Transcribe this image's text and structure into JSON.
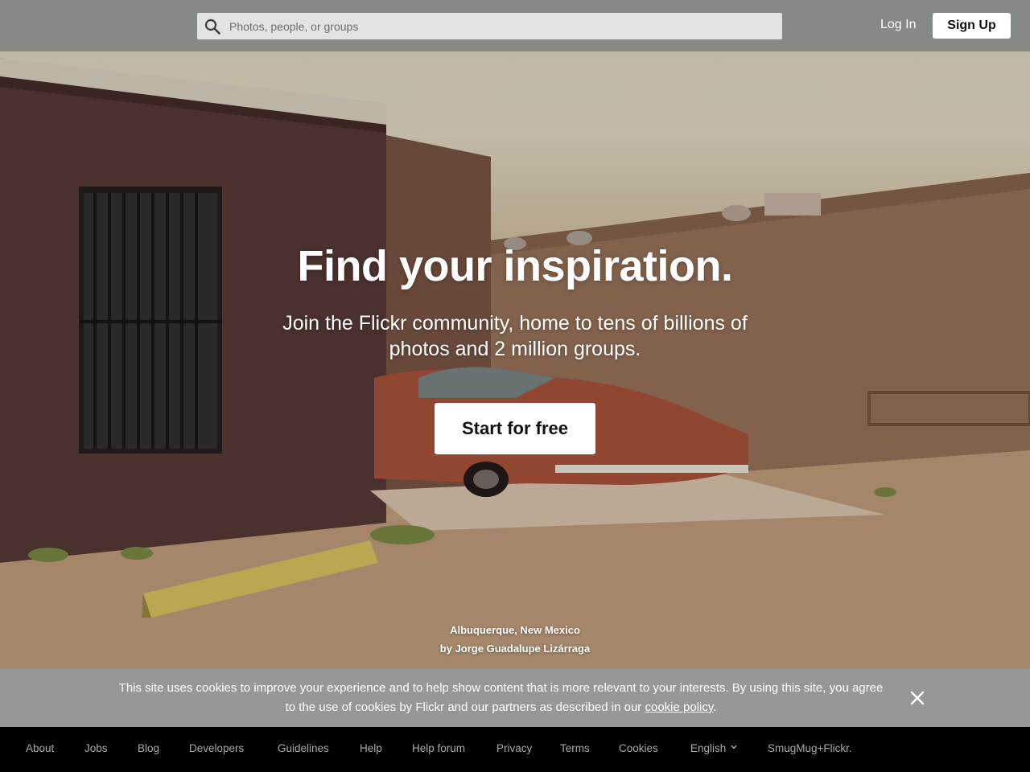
{
  "header": {
    "search_placeholder": "Photos, people, or groups",
    "login_label": "Log In",
    "signup_label": "Sign Up"
  },
  "hero": {
    "headline": "Find your inspiration.",
    "subline": "Join the Flickr community, home to tens of billions of photos and 2 million groups.",
    "cta_label": "Start for free",
    "credit_location": "Albuquerque, New Mexico",
    "credit_author": "by Jorge Guadalupe Lizárraga"
  },
  "cookie_banner": {
    "message": "This site uses cookies to improve your experience and to help show content that is more relevant to your interests. By using this site, you agree to the use of cookies by Flickr and our partners as described in our",
    "link_label": "cookie policy",
    "suffix": ".",
    "close_icon": "close-icon"
  },
  "footer": {
    "links": [
      "About",
      "Jobs",
      "Blog",
      "Developers",
      "Guidelines",
      "Help",
      "Help forum",
      "Privacy",
      "Terms",
      "Cookies",
      "English",
      "SmugMug+Flickr."
    ]
  },
  "colors": {
    "topbar": "#808684",
    "cookie_banner": "#979797",
    "footer": "#000000",
    "footer_link": "#a9a9a9"
  }
}
